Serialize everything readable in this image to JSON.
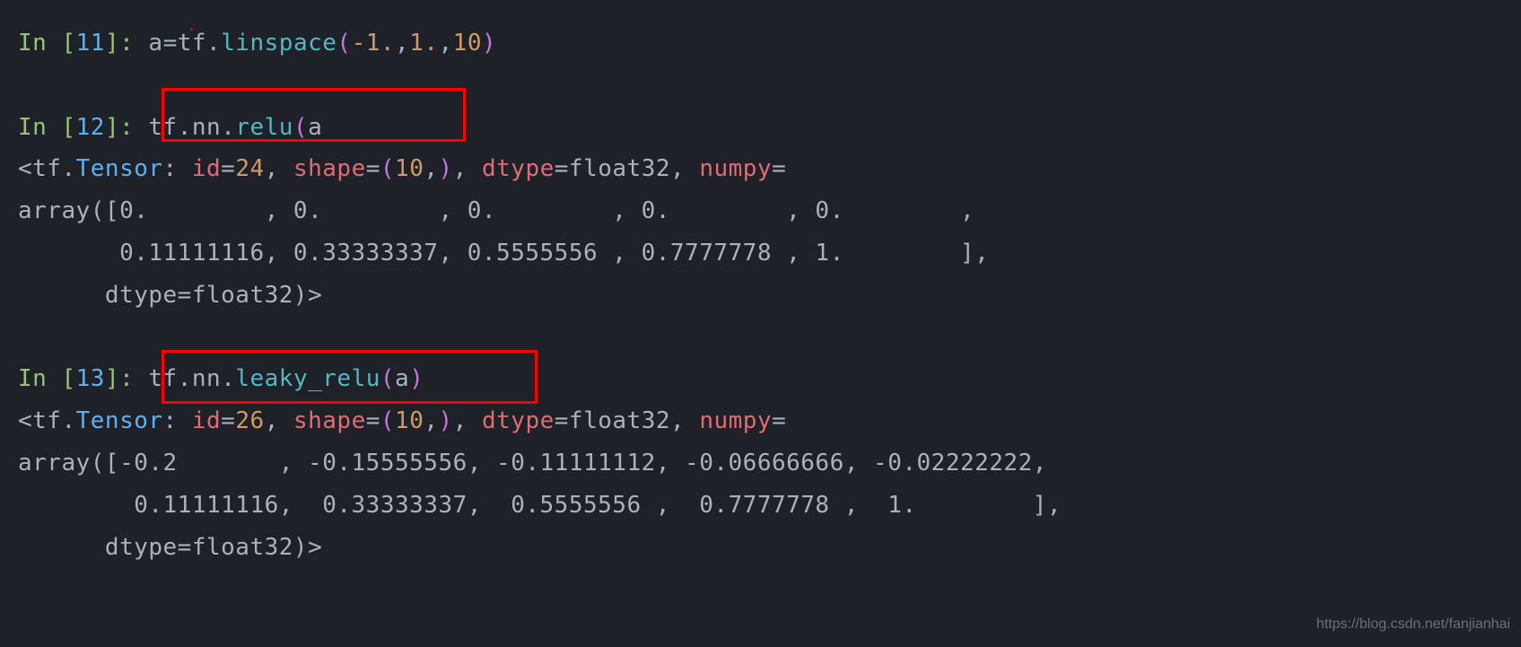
{
  "cells": {
    "cell1": {
      "prompt": "In [",
      "num": "11",
      "prompt_end": "]: ",
      "code_a": "a",
      "code_eq": "=",
      "code_tf": "tf",
      "code_dot1": ".",
      "code_linspace": "linspace",
      "code_open": "(",
      "code_neg1": "-1.",
      "code_c1": ",",
      "code_1": "1.",
      "code_c2": ",",
      "code_10": "10",
      "code_close": ")"
    },
    "cell2": {
      "prompt": "In [",
      "num": "12",
      "prompt_end": "]: ",
      "code_tf": "tf",
      "code_dot1": ".",
      "code_nn": "nn",
      "code_dot2": ".",
      "code_relu": "relu",
      "code_open": "(",
      "code_a": "a"
    },
    "out2": {
      "l1_open": "<",
      "l1_tf": "tf",
      "l1_dot": ".",
      "l1_tensor": "Tensor",
      "l1_colon": ": ",
      "l1_id": "id",
      "l1_eq1": "=",
      "l1_24": "24",
      "l1_c1": ", ",
      "l1_shape": "shape",
      "l1_eq2": "=",
      "l1_po": "(",
      "l1_10": "10",
      "l1_c2": ",",
      "l1_pc": ")",
      "l1_c3": ", ",
      "l1_dtype": "dtype",
      "l1_eq3": "=",
      "l1_f32": "float32",
      "l1_c4": ", ",
      "l1_numpy": "numpy",
      "l1_eq4": "=",
      "l2": "array([0.        , 0.        , 0.        , 0.        , 0.        ,",
      "l3": "       0.11111116, 0.33333337, 0.5555556 , 0.7777778 , 1.        ],",
      "l4": "      dtype=float32)>"
    },
    "cell3": {
      "prompt": "In [",
      "num": "13",
      "prompt_end": "]: ",
      "code_tf": "tf",
      "code_dot1": ".",
      "code_nn": "nn",
      "code_dot2": ".",
      "code_leaky": "leaky_relu",
      "code_open": "(",
      "code_a": "a",
      "code_close": ")"
    },
    "out3": {
      "l1_open": "<",
      "l1_tf": "tf",
      "l1_dot": ".",
      "l1_tensor": "Tensor",
      "l1_colon": ": ",
      "l1_id": "id",
      "l1_eq1": "=",
      "l1_26": "26",
      "l1_c1": ", ",
      "l1_shape": "shape",
      "l1_eq2": "=",
      "l1_po": "(",
      "l1_10": "10",
      "l1_c2": ",",
      "l1_pc": ")",
      "l1_c3": ", ",
      "l1_dtype": "dtype",
      "l1_eq3": "=",
      "l1_f32": "float32",
      "l1_c4": ", ",
      "l1_numpy": "numpy",
      "l1_eq4": "=",
      "l2": "array([-0.2       , -0.15555556, -0.11111112, -0.06666666, -0.02222222,",
      "l3": "        0.11111116,  0.33333337,  0.5555556 ,  0.7777778 ,  1.        ],",
      "l4": "      dtype=float32)>"
    }
  },
  "watermark": "https://blog.csdn.net/fanjianhai"
}
